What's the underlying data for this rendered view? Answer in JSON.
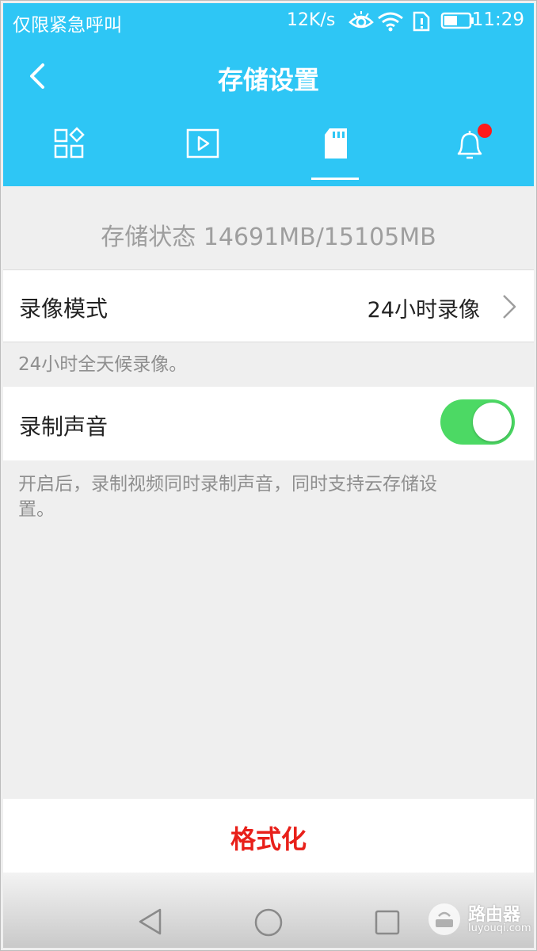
{
  "statusbar": {
    "carrier": "仅限紧急呼叫",
    "speed": "12K/s",
    "time": "11:29",
    "icons": [
      "eye-icon",
      "wifi-icon",
      "sim-icon",
      "battery-icon"
    ]
  },
  "header": {
    "title": "存储设置",
    "back_icon": "chevron-left-icon",
    "tabs": [
      {
        "icon": "apps-grid-icon",
        "active": false
      },
      {
        "icon": "video-play-icon",
        "active": false
      },
      {
        "icon": "sd-card-icon",
        "active": true
      },
      {
        "icon": "bell-icon",
        "active": false,
        "badge": true
      }
    ]
  },
  "storage": {
    "status_text": "存储状态 14691MB/15105MB"
  },
  "record_mode": {
    "label": "录像模式",
    "value": "24小时录像",
    "description": "24小时全天候录像。"
  },
  "record_audio": {
    "label": "录制声音",
    "enabled": true,
    "description_line1": "开启后，录制视频同时录制声音，同时支持云存储设",
    "description_line2": "置。"
  },
  "format_button": {
    "label": "格式化"
  },
  "navbar": {
    "icons": [
      "back-triangle-icon",
      "home-circle-icon",
      "recents-square-icon"
    ]
  },
  "watermark": {
    "title": "路由器",
    "site": "luyouqi.com"
  },
  "colors": {
    "header_bg": "#2ec6f5",
    "toggle_on": "#4cd964",
    "format_text": "#e8201a",
    "badge": "#ff1a1a"
  }
}
